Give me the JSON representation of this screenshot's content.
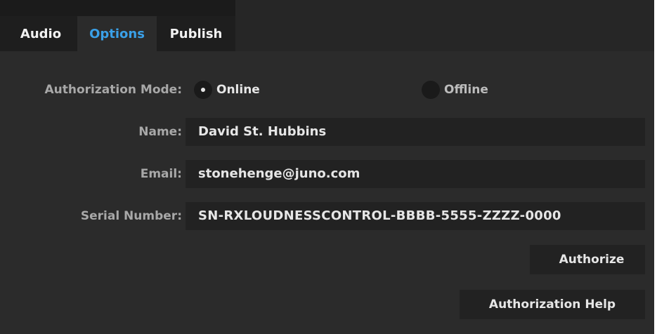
{
  "tabs": [
    {
      "label": "Audio",
      "active": false
    },
    {
      "label": "Options",
      "active": true
    },
    {
      "label": "Publish",
      "active": false
    }
  ],
  "form": {
    "authorization_mode": {
      "label": "Authorization Mode:",
      "options": [
        "Online",
        "Offline"
      ],
      "selected": "Online"
    },
    "name": {
      "label": "Name:",
      "value": "David St. Hubbins"
    },
    "email": {
      "label": "Email:",
      "value": "stonehenge@juno.com"
    },
    "serial": {
      "label": "Serial Number:",
      "value": "SN-RXLOUDNESSCONTROL-BBBB-5555-ZZZZ-0000"
    }
  },
  "buttons": {
    "authorize": "Authorize",
    "help": "Authorization Help"
  },
  "colors": {
    "active_tab_text": "#3aa0e8",
    "background": "#2b2b2b",
    "field_background": "#222222"
  }
}
